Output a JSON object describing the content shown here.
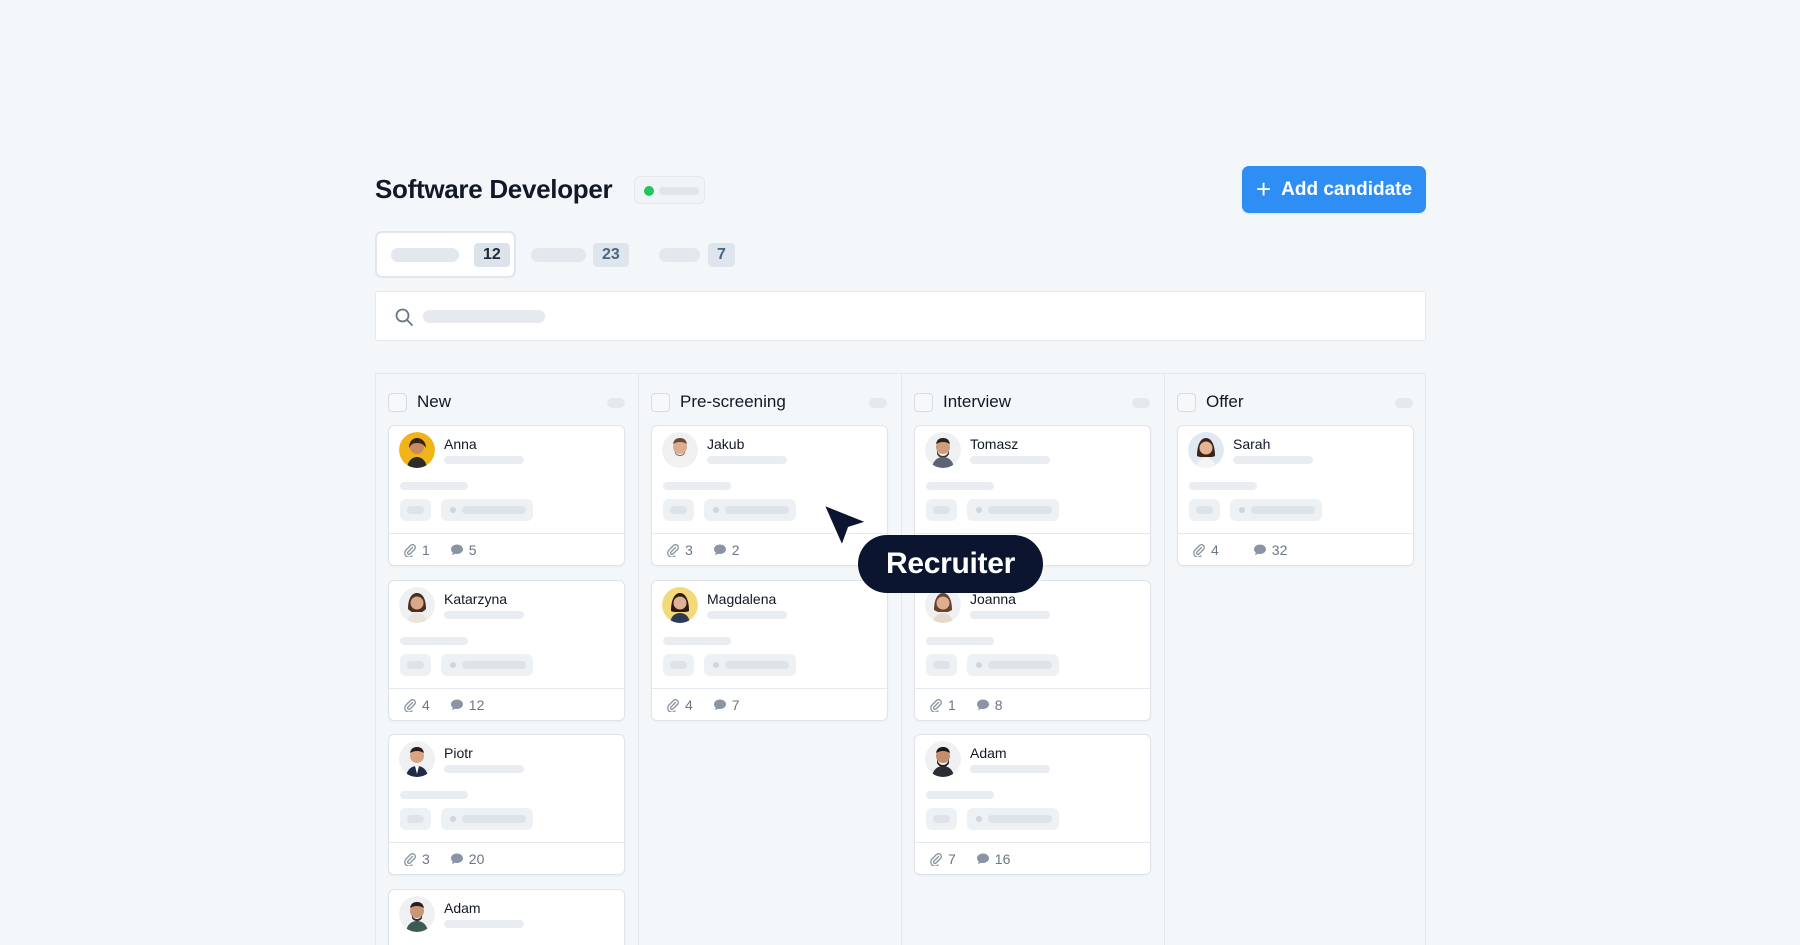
{
  "header": {
    "title": "Software Developer",
    "status_color": "#22c55e",
    "add_button_label": "Add candidate",
    "add_button_icon": "plus-icon",
    "accent": "#2f8ef4"
  },
  "tabs": [
    {
      "count": "12",
      "active": true
    },
    {
      "count": "23",
      "active": false
    },
    {
      "count": "7",
      "active": false
    }
  ],
  "search": {
    "icon": "search-icon"
  },
  "columns": [
    {
      "title": "New",
      "cards": [
        {
          "name": "Anna",
          "attachments": "1",
          "comments": "5"
        },
        {
          "name": "Katarzyna",
          "attachments": "4",
          "comments": "12"
        },
        {
          "name": "Piotr",
          "attachments": "3",
          "comments": "20"
        },
        {
          "name": "Adam",
          "attachments": "",
          "comments": ""
        }
      ]
    },
    {
      "title": "Pre-screening",
      "cards": [
        {
          "name": "Jakub",
          "attachments": "3",
          "comments": "2"
        },
        {
          "name": "Magdalena",
          "attachments": "4",
          "comments": "7"
        }
      ]
    },
    {
      "title": "Interview",
      "cards": [
        {
          "name": "Tomasz",
          "attachments": "",
          "comments": ""
        },
        {
          "name": "Joanna",
          "attachments": "1",
          "comments": "8"
        },
        {
          "name": "Adam",
          "attachments": "7",
          "comments": "16"
        }
      ]
    },
    {
      "title": "Offer",
      "cards": [
        {
          "name": "Sarah",
          "attachments": "4",
          "comments": "32"
        }
      ]
    }
  ],
  "cursor_label": "Recruiter"
}
